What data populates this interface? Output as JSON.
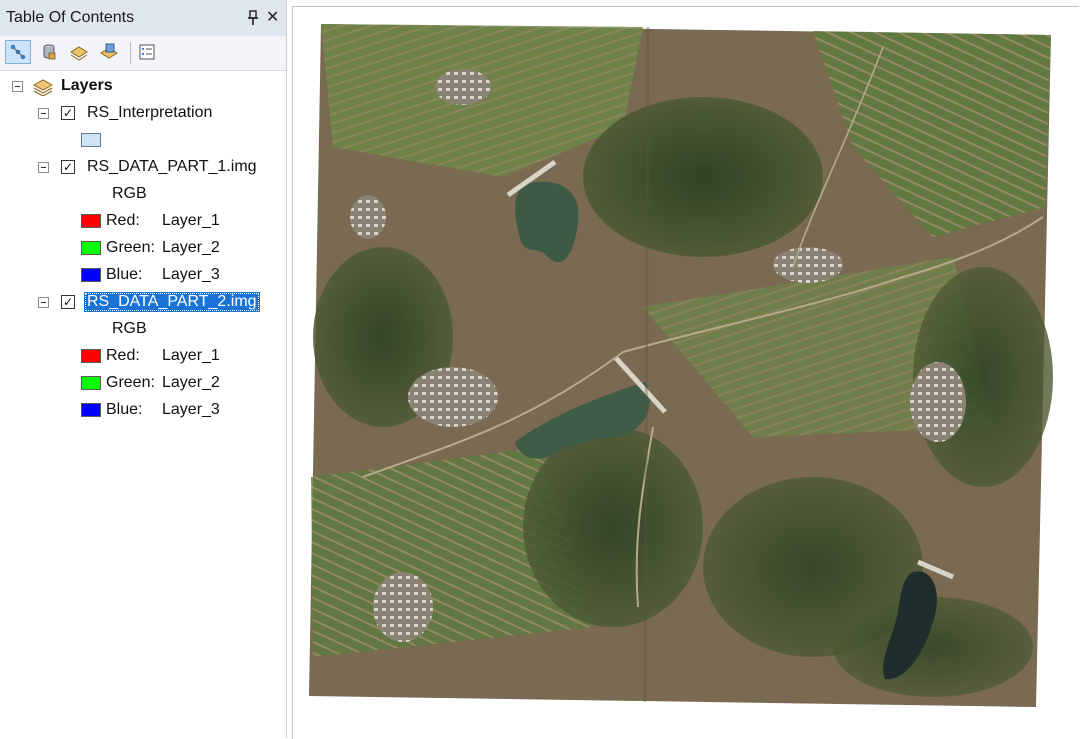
{
  "toc": {
    "title": "Table Of Contents",
    "pin_icon": "pin-icon",
    "close_icon": "close-icon",
    "close_glyph": "✕",
    "toolbar": [
      {
        "name": "list-by-drawing-order-icon",
        "active": true
      },
      {
        "name": "list-by-source-icon",
        "active": false
      },
      {
        "name": "list-by-visibility-icon",
        "active": false
      },
      {
        "name": "list-by-selection-icon",
        "active": false
      },
      {
        "name": "options-icon",
        "active": false
      }
    ],
    "root": {
      "label": "Layers",
      "icon": "layers-icon"
    },
    "layers": [
      {
        "name": "RS_Interpretation",
        "checked": true,
        "symbol_color": "#cfe3f5"
      },
      {
        "name": "RS_DATA_PART_1.img",
        "checked": true,
        "render": "RGB",
        "bands": [
          {
            "channel": "Red:",
            "band": "Layer_1",
            "color": "#ff0000"
          },
          {
            "channel": "Green:",
            "band": "Layer_2",
            "color": "#00ff00"
          },
          {
            "channel": "Blue:",
            "band": "Layer_3",
            "color": "#0000ff"
          }
        ]
      },
      {
        "name": "RS_DATA_PART_2.img",
        "checked": true,
        "selected": true,
        "render": "RGB",
        "bands": [
          {
            "channel": "Red:",
            "band": "Layer_1",
            "color": "#ff0000"
          },
          {
            "channel": "Green:",
            "band": "Layer_2",
            "color": "#00ff00"
          },
          {
            "channel": "Blue:",
            "band": "Layer_3",
            "color": "#0000ff"
          }
        ]
      }
    ],
    "check_glyph": "✓"
  },
  "map": {
    "content": "satellite-imagery",
    "colors": {
      "terrain": "#7a6a52",
      "vegetation": "#3f5a2e",
      "field": "#6f8a48",
      "water": "#3d5a45",
      "village": "#b9b4aa"
    }
  }
}
